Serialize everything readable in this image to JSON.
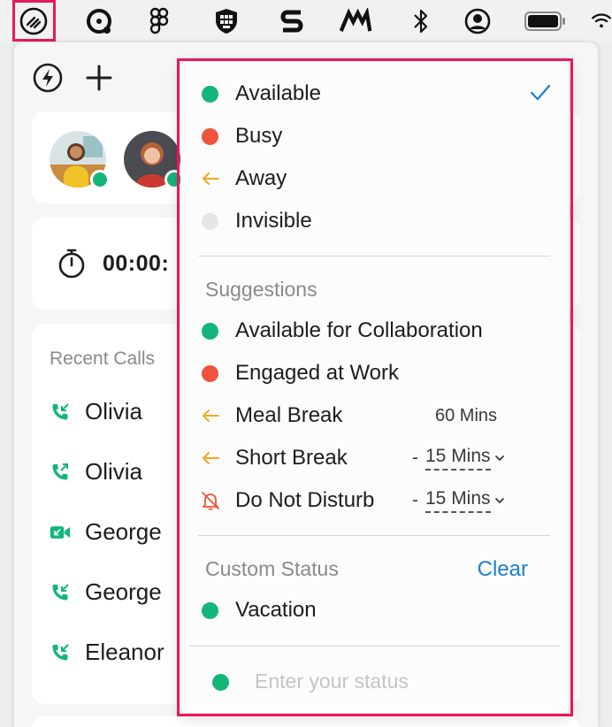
{
  "menubar": {
    "icons": [
      "app-logo-icon",
      "sync-icon",
      "figma-icon",
      "shield-icon",
      "s-app-icon",
      "m-app-icon",
      "bluetooth-icon",
      "user-account-icon",
      "battery-icon",
      "wifi-icon"
    ]
  },
  "app": {
    "timer": "00:00:",
    "recent_title": "Recent Calls",
    "recent_calls": [
      {
        "name": "Olivia",
        "icon": "incoming-call-icon"
      },
      {
        "name": "Olivia",
        "icon": "outgoing-call-icon"
      },
      {
        "name": "George",
        "icon": "video-call-icon"
      },
      {
        "name": "George",
        "icon": "incoming-call-icon"
      },
      {
        "name": "Eleanor",
        "icon": "incoming-call-icon"
      }
    ]
  },
  "status_menu": {
    "statuses": [
      {
        "label": "Available",
        "color": "#14b57b",
        "selected": true
      },
      {
        "label": "Busy",
        "color": "#f0533d"
      },
      {
        "label": "Away",
        "color": "#f5a623",
        "icon": "arrow-left-icon"
      },
      {
        "label": "Invisible",
        "color": "#e6e6e8"
      }
    ],
    "suggestions_title": "Suggestions",
    "suggestions": [
      {
        "label": "Available for Collaboration",
        "color": "#14b57b"
      },
      {
        "label": "Engaged at Work",
        "color": "#f0533d"
      },
      {
        "label": "Meal Break",
        "duration": "60 Mins",
        "icon": "arrow-left-icon"
      },
      {
        "label": "Short Break",
        "duration": "15 Mins",
        "dash": "-",
        "icon": "arrow-left-icon"
      },
      {
        "label": "Do Not Disturb",
        "duration": "15 Mins",
        "dash": "-",
        "icon": "bell-off-icon"
      }
    ],
    "custom_title": "Custom Status",
    "clear_label": "Clear",
    "custom": [
      {
        "label": "Vacation",
        "color": "#14b57b"
      }
    ],
    "input_placeholder": "Enter your status"
  },
  "colors": {
    "highlight": "#e8185c",
    "accent": "#1b7fd0",
    "available": "#14b57b",
    "busy": "#f0533d",
    "away": "#f5a623"
  }
}
